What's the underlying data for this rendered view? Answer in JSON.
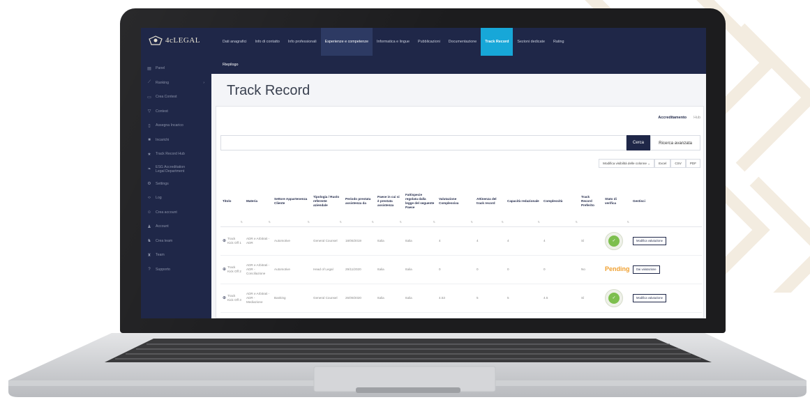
{
  "app": {
    "logo_text": "4cLEGAL"
  },
  "sidebar": {
    "items": [
      {
        "icon": "panel-icon",
        "label": "Panel"
      },
      {
        "icon": "chart-icon",
        "label": "Ranking"
      },
      {
        "icon": "monitor-icon",
        "label": "Crea Contest"
      },
      {
        "icon": "trophy-icon",
        "label": "Contest"
      },
      {
        "icon": "document-icon",
        "label": "Assegna Incarico"
      },
      {
        "icon": "folder-icon",
        "label": "Incarichi"
      },
      {
        "icon": "star-icon",
        "label": "Track Record Hub"
      },
      {
        "icon": "leaf-icon",
        "label": "ESG Accreditation Legal Department"
      },
      {
        "icon": "gear-icon",
        "label": "Settings"
      },
      {
        "icon": "code-icon",
        "label": "Log"
      },
      {
        "icon": "user-plus-icon",
        "label": "Crea account"
      },
      {
        "icon": "user-icon",
        "label": "Account"
      },
      {
        "icon": "team-plus-icon",
        "label": "Crea team"
      },
      {
        "icon": "team-icon",
        "label": "Team"
      },
      {
        "icon": "help-icon",
        "label": "Supporto"
      }
    ]
  },
  "topnav": {
    "tabs": [
      "Dati anagrafici",
      "Info di contatto",
      "Info professionali",
      "Esperienze e competenze",
      "Informatica e lingue",
      "Pubblicazioni",
      "Documentazione",
      "Track Record",
      "Sezioni dedicate",
      "Rating"
    ],
    "active": "Esperienze e competenze",
    "highlighted": "Track Record",
    "subtab": "Riepilogo"
  },
  "page": {
    "title": "Track Record"
  },
  "toggle": {
    "accreditamento": "Accreditamento",
    "hub": "Hub"
  },
  "search": {
    "button": "Cerca",
    "advanced": "Ricerca avanzata"
  },
  "tools": {
    "columns": "Modifica visibilità delle colonne",
    "excel": "Excel",
    "csv": "CSV",
    "pdf": "PDF"
  },
  "table": {
    "headers": [
      "Titolo",
      "Materia",
      "Settore Appartenenza Cliente",
      "Tipologia / Ruolo referente aziendale",
      "Periodo prestata assistenza da",
      "Paese in cui si è prestata assistenza",
      "Fattispecie regolata dalla legge del seguente Paese",
      "Valutazione Complessiva",
      "Attinenza del track record",
      "Capacità redazionale",
      "Complessità",
      "Track Record Preferito",
      "Stato di verifica",
      "Gestisci"
    ],
    "rows": [
      {
        "titolo": "Track Kick Off 1",
        "materia": "ADR e Arbitrati - ADR",
        "settore": "Automotive",
        "ruolo": "General Counsel",
        "periodo": "18/06/2019",
        "paese": "Italia",
        "legge": "Italia",
        "valutazione": "4",
        "attinenza": "4",
        "capacita": "4",
        "complessita": "4",
        "preferito": "Sì",
        "stato": "verified",
        "azione": "Modifica valutazione"
      },
      {
        "titolo": "Track Kick Off 2",
        "materia": "ADR e Arbitrati - ADR - Conciliazione",
        "settore": "Automotive",
        "ruolo": "Head of Legal",
        "periodo": "29/11/2020",
        "paese": "Italia",
        "legge": "Italia",
        "valutazione": "0",
        "attinenza": "0",
        "capacita": "0",
        "complessita": "0",
        "preferito": "No",
        "stato": "Pending",
        "azione": "Dai valutazione"
      },
      {
        "titolo": "Track Kick Off 3",
        "materia": "ADR e Arbitrati - ADR - Mediazione",
        "settore": "Banking",
        "ruolo": "General Counsel",
        "periodo": "26/09/2020",
        "paese": "Italia",
        "legge": "Italia",
        "valutazione": "4.53",
        "attinenza": "5",
        "capacita": "5",
        "complessita": "4.5",
        "preferito": "Sì",
        "stato": "verified",
        "azione": "Modifica valutazione"
      }
    ]
  }
}
